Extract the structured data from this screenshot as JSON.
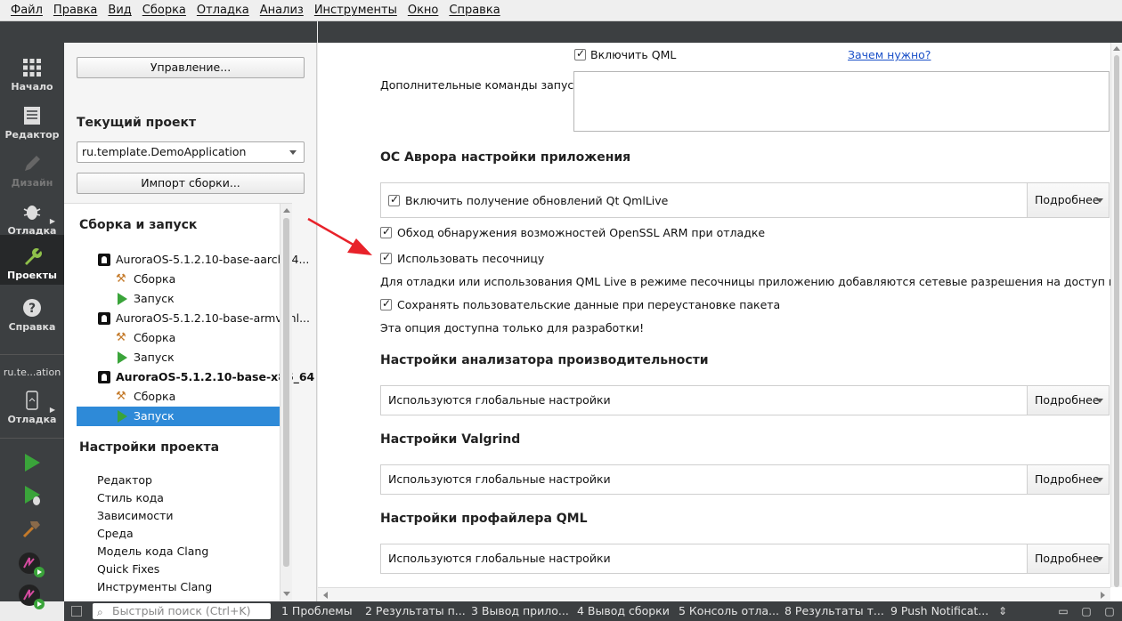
{
  "menu": [
    "Файл",
    "Правка",
    "Вид",
    "Сборка",
    "Отладка",
    "Анализ",
    "Инструменты",
    "Окно",
    "Справка"
  ],
  "modes": {
    "welcome": "Начало",
    "edit": "Редактор",
    "design": "Дизайн",
    "debug": "Отладка",
    "projects": "Проекты",
    "help": "Справка"
  },
  "kit_selector": {
    "name": "ru.te...ation",
    "mode": "Отладка"
  },
  "sidebar": {
    "manage_button": "Управление...",
    "current_project_title": "Текущий проект",
    "current_project": "ru.template.DemoApplication",
    "import_button": "Импорт сборки...",
    "build_run_title": "Сборка и запуск",
    "kits": [
      {
        "name": "AuroraOS-5.1.2.10-base-aarch64...",
        "build": "Сборка",
        "run": "Запуск"
      },
      {
        "name": "AuroraOS-5.1.2.10-base-armv7hl...",
        "build": "Сборка",
        "run": "Запуск"
      },
      {
        "name": "AuroraOS-5.1.2.10-base-x86_64 ...",
        "build": "Сборка",
        "run": "Запуск"
      }
    ],
    "project_settings_title": "Настройки проекта",
    "project_settings": [
      "Редактор",
      "Стиль кода",
      "Зависимости",
      "Среда",
      "Модель кода Clang",
      "Quick Fixes",
      "Инструменты Clang"
    ]
  },
  "main": {
    "enable_qml": "Включить QML",
    "why_link": "Зачем нужно?",
    "extra_cmds_label": "Дополнительные команды запуска:",
    "aurora_title": "ОС Аврора настройки приложения",
    "qmllive_check": "Включить получение обновлений Qt QmlLive",
    "details": "Подробнее",
    "openssl_check": "Обход обнаружения возможностей OpenSSL ARM при отладке",
    "sandbox_check": "Использовать песочницу",
    "sandbox_note": "Для отладки или использования QML Live в режиме песочницы приложению добавляются сетевые разрешения на доступ к сети!",
    "keep_data_check": "Сохранять пользовательские данные при переустановке пакета",
    "dev_only_note": "Эта опция доступна только для разработки!",
    "perf_title": "Настройки анализатора производительности",
    "global_settings": "Используются глобальные настройки",
    "valgrind_title": "Настройки Valgrind",
    "qml_profiler_title": "Настройки профайлера QML"
  },
  "statusbar": {
    "search_placeholder": "Быстрый поиск (Ctrl+K)",
    "panes": [
      "1  Проблемы",
      "2  Результаты п...",
      "3  Вывод прило...",
      "4  Вывод сборки",
      "5  Консоль отла...",
      "8  Результаты т...",
      "9  Push Notificat..."
    ]
  },
  "colors": {
    "accent": "#2e8ad8",
    "modebar": "#3c3f41",
    "run_green": "#3aa43a",
    "annotation_red": "#e8222a"
  }
}
